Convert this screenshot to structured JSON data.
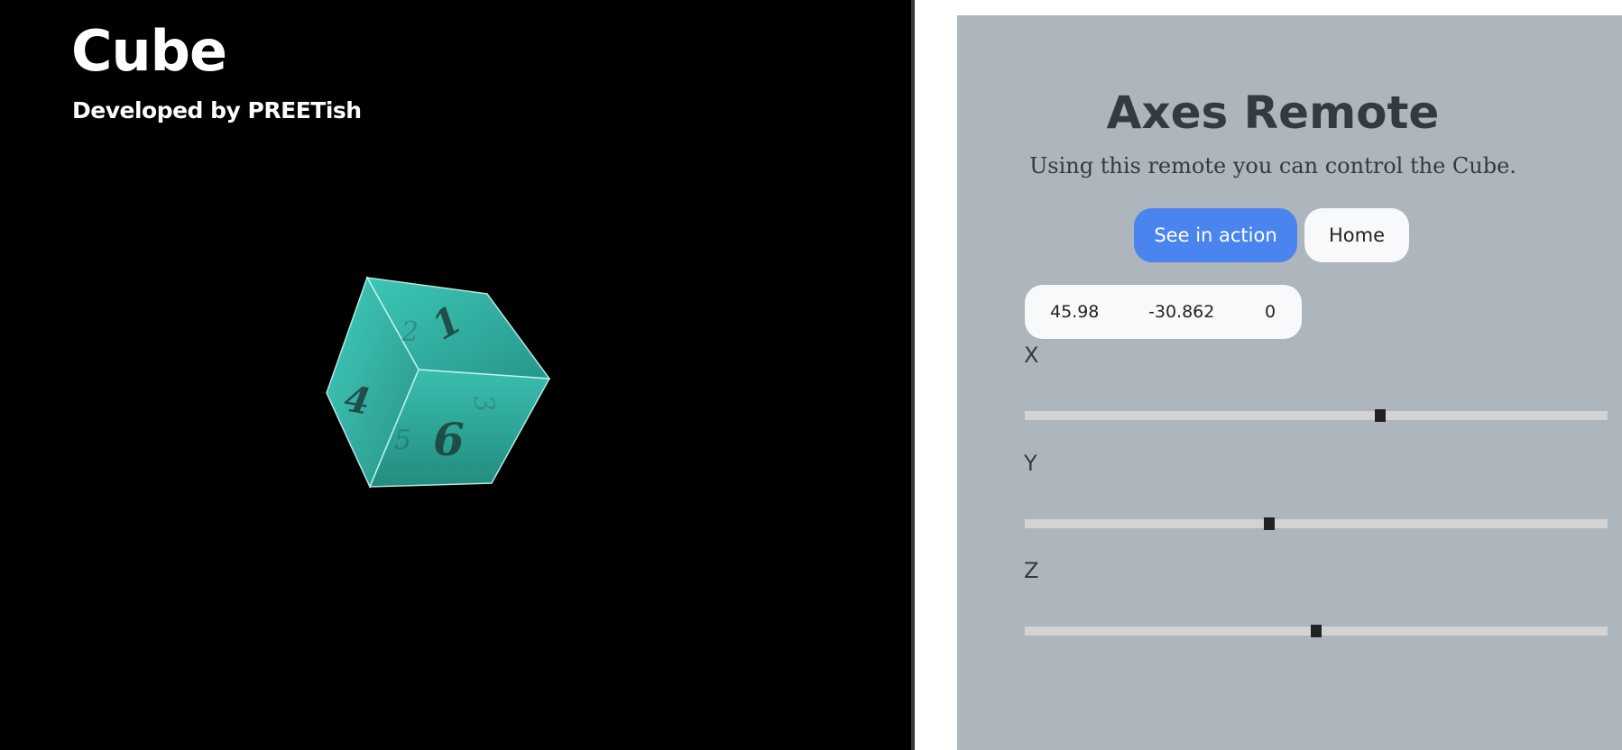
{
  "cube_app": {
    "title": "Cube",
    "subtitle": "Developed by PREETish",
    "cube_color": "#3cc4b4",
    "visible_face_numbers": [
      "1",
      "2",
      "3",
      "4",
      "5",
      "6"
    ]
  },
  "remote": {
    "title": "Axes Remote",
    "description": "Using this remote you can control the Cube.",
    "buttons": {
      "see_in_action": "See in action",
      "home": "Home"
    },
    "readout": {
      "x": "45.98",
      "y": "-30.862",
      "z": "0"
    },
    "sliders": [
      {
        "label": "X",
        "value_fraction": 0.61
      },
      {
        "label": "Y",
        "value_fraction": 0.42
      },
      {
        "label": "Z",
        "value_fraction": 0.5
      }
    ]
  },
  "colors": {
    "left_background": "#000000",
    "remote_background": "#adb5bd",
    "primary_button": "#4a84ee",
    "light_button": "#f8f9fa",
    "text_dark": "#343a40"
  }
}
